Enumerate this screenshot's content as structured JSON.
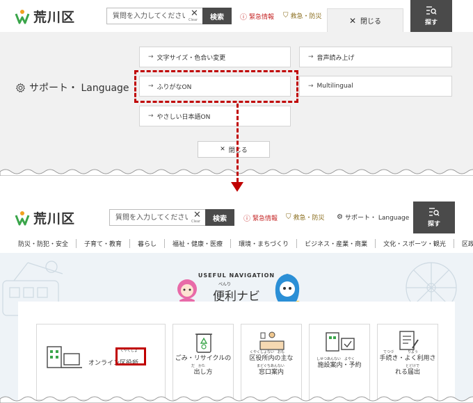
{
  "header": {
    "logo_text": "荒川区",
    "search_placeholder": "質問を入力してください",
    "clear_label": "Clear",
    "search_button": "検索",
    "emergency": "緊急情報",
    "disaster": "救急・防災",
    "support_link": "サポート・ Language",
    "find_button": "探す"
  },
  "support_panel": {
    "close_tab": "閉じる",
    "title": "サポート・ Language",
    "options": {
      "text_size": "文字サイズ・色合い変更",
      "read_aloud": "音声読み上げ",
      "furigana": "ふりがなON",
      "multilingual": "Multilingual",
      "easy_japanese": "やさしい日本語ON"
    },
    "close_button": "閉じる"
  },
  "nav": {
    "items": [
      "防災・防犯・安全",
      "子育て・教育",
      "暮らし",
      "福祉・健康・医療",
      "環境・まちづくり",
      "ビジネス・産業・商業",
      "文化・スポーツ・観光",
      "区政情報"
    ]
  },
  "hero": {
    "useful_label": "USEFUL NAVIGATION",
    "title": "便利ナビ",
    "title_ruby": "べんり"
  },
  "cards": {
    "online": "オンライン区役所",
    "online_ruby": "くやくしょ",
    "garbage_line1": "ごみ・リサイクルの",
    "garbage_line2": "出し方",
    "garbage_ruby": "だ　かた",
    "office_line1": "区役所内の主な",
    "office_line2": "窓口案内",
    "office_ruby1": "くやくしょない　おも",
    "office_ruby2": "まどぐちあんない",
    "facility_line1": "施設案内・予約",
    "facility_ruby": "しせつあんない　よやく",
    "procedure_line1": "手続き・よく利用さ",
    "procedure_line2": "れる届出",
    "procedure_ruby1": "てつづ　　　　りよう",
    "procedure_ruby2": "とどけで"
  },
  "colors": {
    "accent_red": "#c00000",
    "dark_button": "#4a4a4a",
    "panel_bg": "#f1f1f1",
    "logo_green": "#3aa54a"
  }
}
